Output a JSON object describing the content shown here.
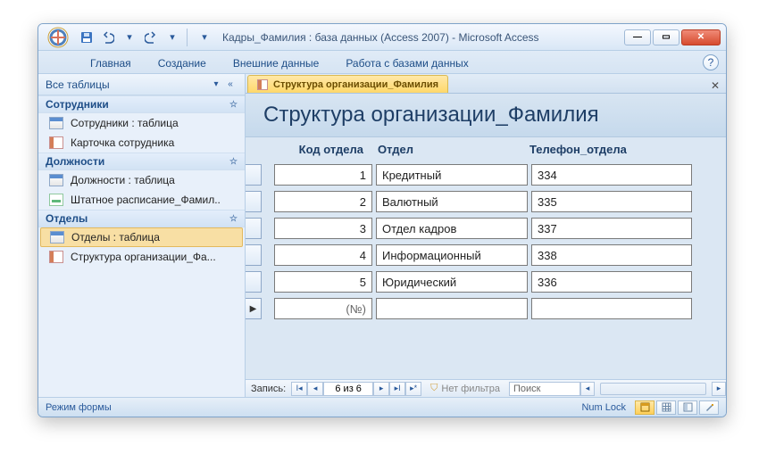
{
  "titlebar": {
    "title": "Кадры_Фамилия : база данных (Access 2007) - Microsoft Access"
  },
  "ribbon": {
    "tabs": [
      "Главная",
      "Создание",
      "Внешние данные",
      "Работа с базами данных"
    ]
  },
  "nav": {
    "title": "Все таблицы",
    "groups": [
      {
        "label": "Сотрудники",
        "items": [
          {
            "kind": "table",
            "label": "Сотрудники : таблица"
          },
          {
            "kind": "form",
            "label": "Карточка сотрудника"
          }
        ]
      },
      {
        "label": "Должности",
        "items": [
          {
            "kind": "table",
            "label": "Должности : таблица"
          },
          {
            "kind": "report",
            "label": "Штатное расписание_Фамил.."
          }
        ]
      },
      {
        "label": "Отделы",
        "items": [
          {
            "kind": "table",
            "label": "Отделы : таблица",
            "selected": true
          },
          {
            "kind": "form",
            "label": "Структура организации_Фа..."
          }
        ]
      }
    ]
  },
  "doc": {
    "tab_label": "Структура организации_Фамилия",
    "form_title": "Структура организации_Фамилия",
    "headers": {
      "code": "Код отдела",
      "dept": "Отдел",
      "phone": "Телефон_отдела"
    },
    "rows": [
      {
        "code": "1",
        "dept": "Кредитный",
        "phone": "334"
      },
      {
        "code": "2",
        "dept": "Валютный",
        "phone": "335"
      },
      {
        "code": "3",
        "dept": "Отдел кадров",
        "phone": "337"
      },
      {
        "code": "4",
        "dept": "Информационный",
        "phone": "338"
      },
      {
        "code": "5",
        "dept": "Юридический",
        "phone": "336"
      }
    ],
    "new_row_placeholder": "(№)",
    "recordnav": {
      "label": "Запись:",
      "counter": "6 из 6",
      "filter_label": "Нет фильтра",
      "search_placeholder": "Поиск"
    }
  },
  "statusbar": {
    "mode": "Режим формы",
    "numlock": "Num Lock"
  }
}
